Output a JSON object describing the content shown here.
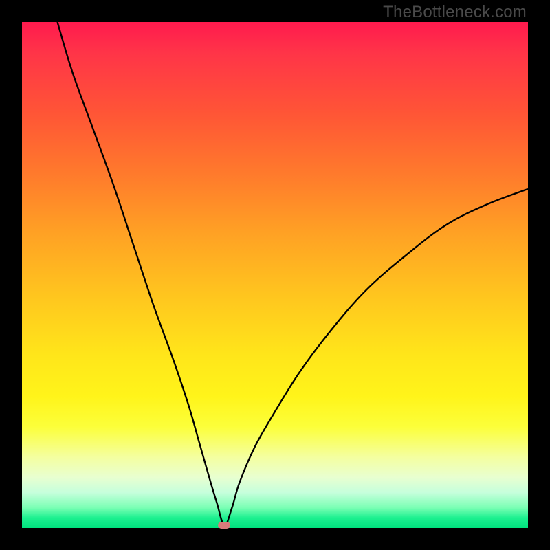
{
  "watermark": "TheBottleneck.com",
  "colors": {
    "frame": "#000000",
    "curve": "#000000",
    "marker": "#d77b7b",
    "gradient_top": "#ff1a4e",
    "gradient_bottom": "#00e27e"
  },
  "chart_data": {
    "type": "line",
    "title": "",
    "xlabel": "",
    "ylabel": "",
    "xlim": [
      0,
      100
    ],
    "ylim": [
      0,
      100
    ],
    "notes": "V-shaped bottleneck curve; minimum near x≈40 at y≈0. Left branch starts at (x≈7, y≈100); right branch ends at (x≈100, y≈67).",
    "marker": {
      "x": 40,
      "y": 0.5
    },
    "series": [
      {
        "name": "bottleneck-curve",
        "x": [
          7,
          10,
          14,
          18,
          22,
          26,
          30,
          33,
          35,
          37,
          38.5,
          40,
          41.5,
          43,
          46,
          50,
          55,
          61,
          68,
          76,
          84,
          92,
          100
        ],
        "y": [
          100,
          90,
          79,
          68,
          56,
          44,
          33,
          24,
          17,
          10,
          5,
          0.5,
          4,
          9,
          16,
          23,
          31,
          39,
          47,
          54,
          60,
          64,
          67
        ]
      }
    ]
  }
}
